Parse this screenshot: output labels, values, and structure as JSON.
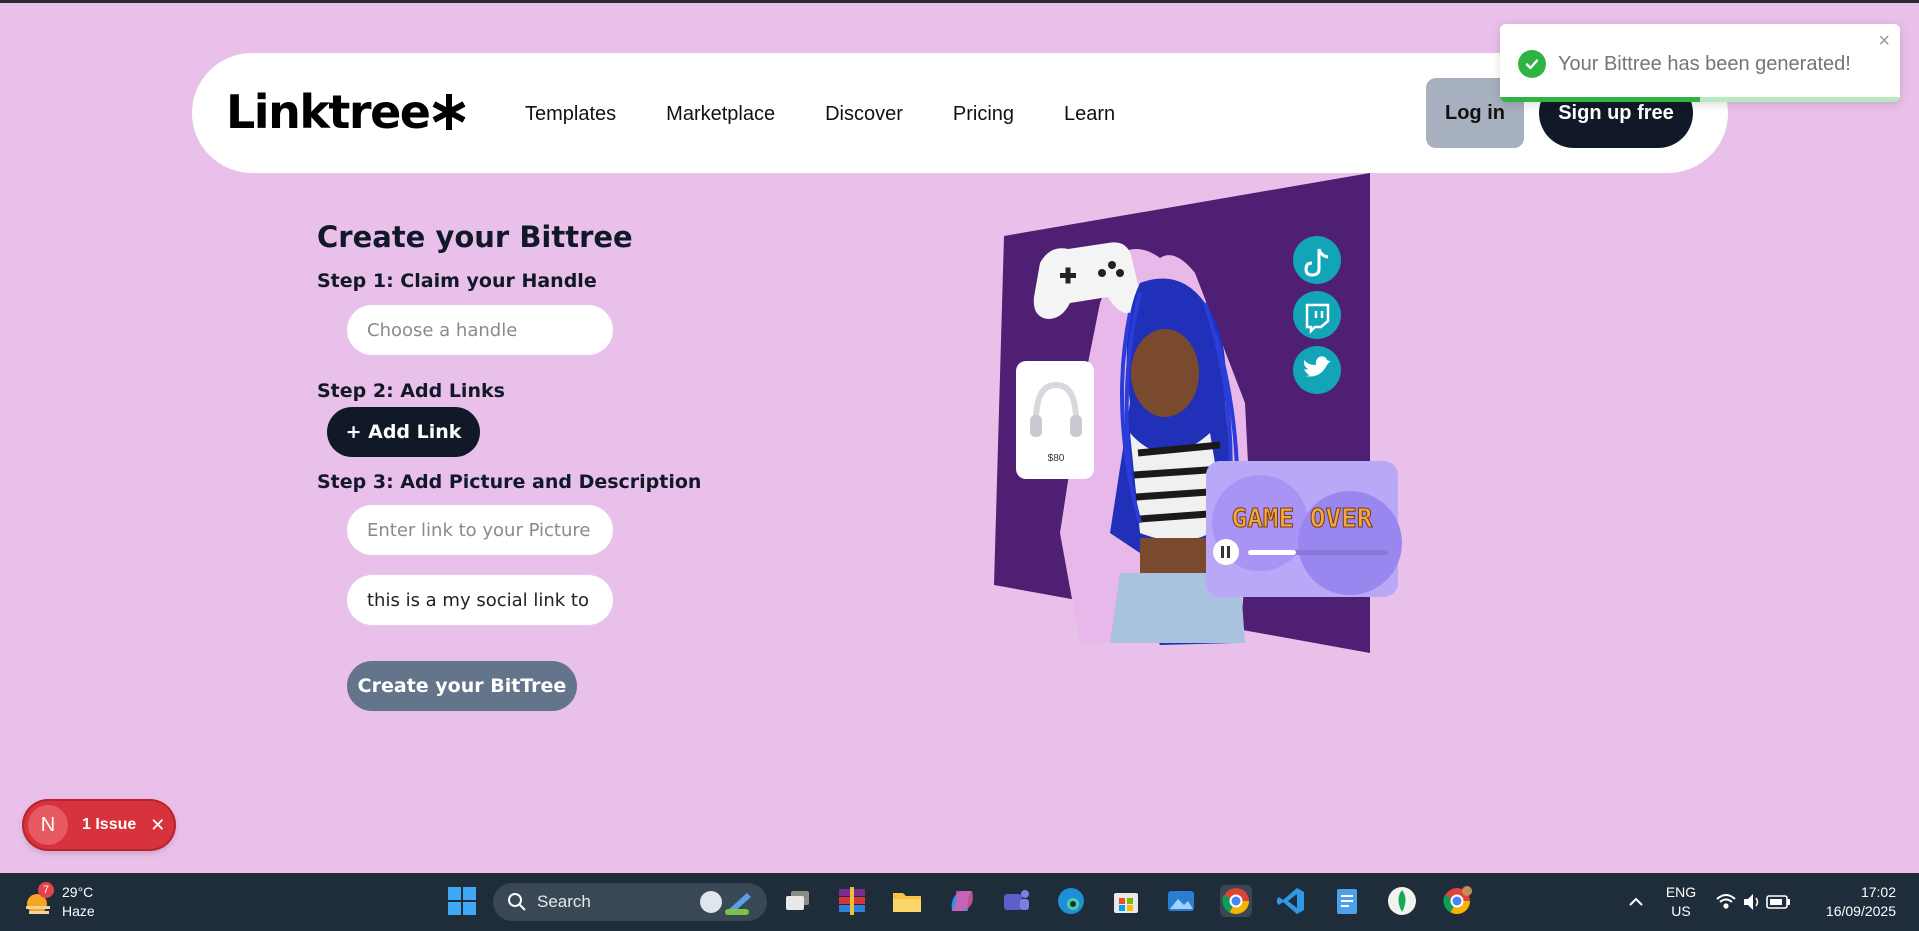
{
  "nav": {
    "logo": "Linktree",
    "links": [
      "Templates",
      "Marketplace",
      "Discover",
      "Pricing",
      "Learn"
    ],
    "login_label": "Log in",
    "signup_label": "Sign up free"
  },
  "toast": {
    "message": "Your Bittree has been generated!",
    "close_glyph": "×",
    "progress": 0.5
  },
  "form": {
    "title": "Create your Bittree",
    "step1": "Step 1: Claim your Handle",
    "handle_placeholder": "Choose a handle",
    "step2": "Step 2: Add Links",
    "add_link_label": "+ Add Link",
    "step3": "Step 3: Add Picture and Description",
    "picture_placeholder": "Enter link to your Picture",
    "description_value": "this is a my social link to a",
    "create_label": "Create your BitTree"
  },
  "hero": {
    "price_tag": "$80",
    "game_text": "GAME OVER"
  },
  "issue_badge": {
    "avatar": "N",
    "label": "1 Issue",
    "close_glyph": "✕"
  },
  "taskbar": {
    "weather_badge": "7",
    "temperature": "29°C",
    "condition": "Haze",
    "search_label": "Search",
    "lang_primary": "ENG",
    "lang_secondary": "US",
    "time": "17:02",
    "date": "16/09/2025"
  },
  "colors": {
    "background": "#e9c0e9",
    "dark": "#111827",
    "hero_purple": "#4f1f73",
    "success": "#2fb344",
    "issue_red": "#d8323c"
  }
}
